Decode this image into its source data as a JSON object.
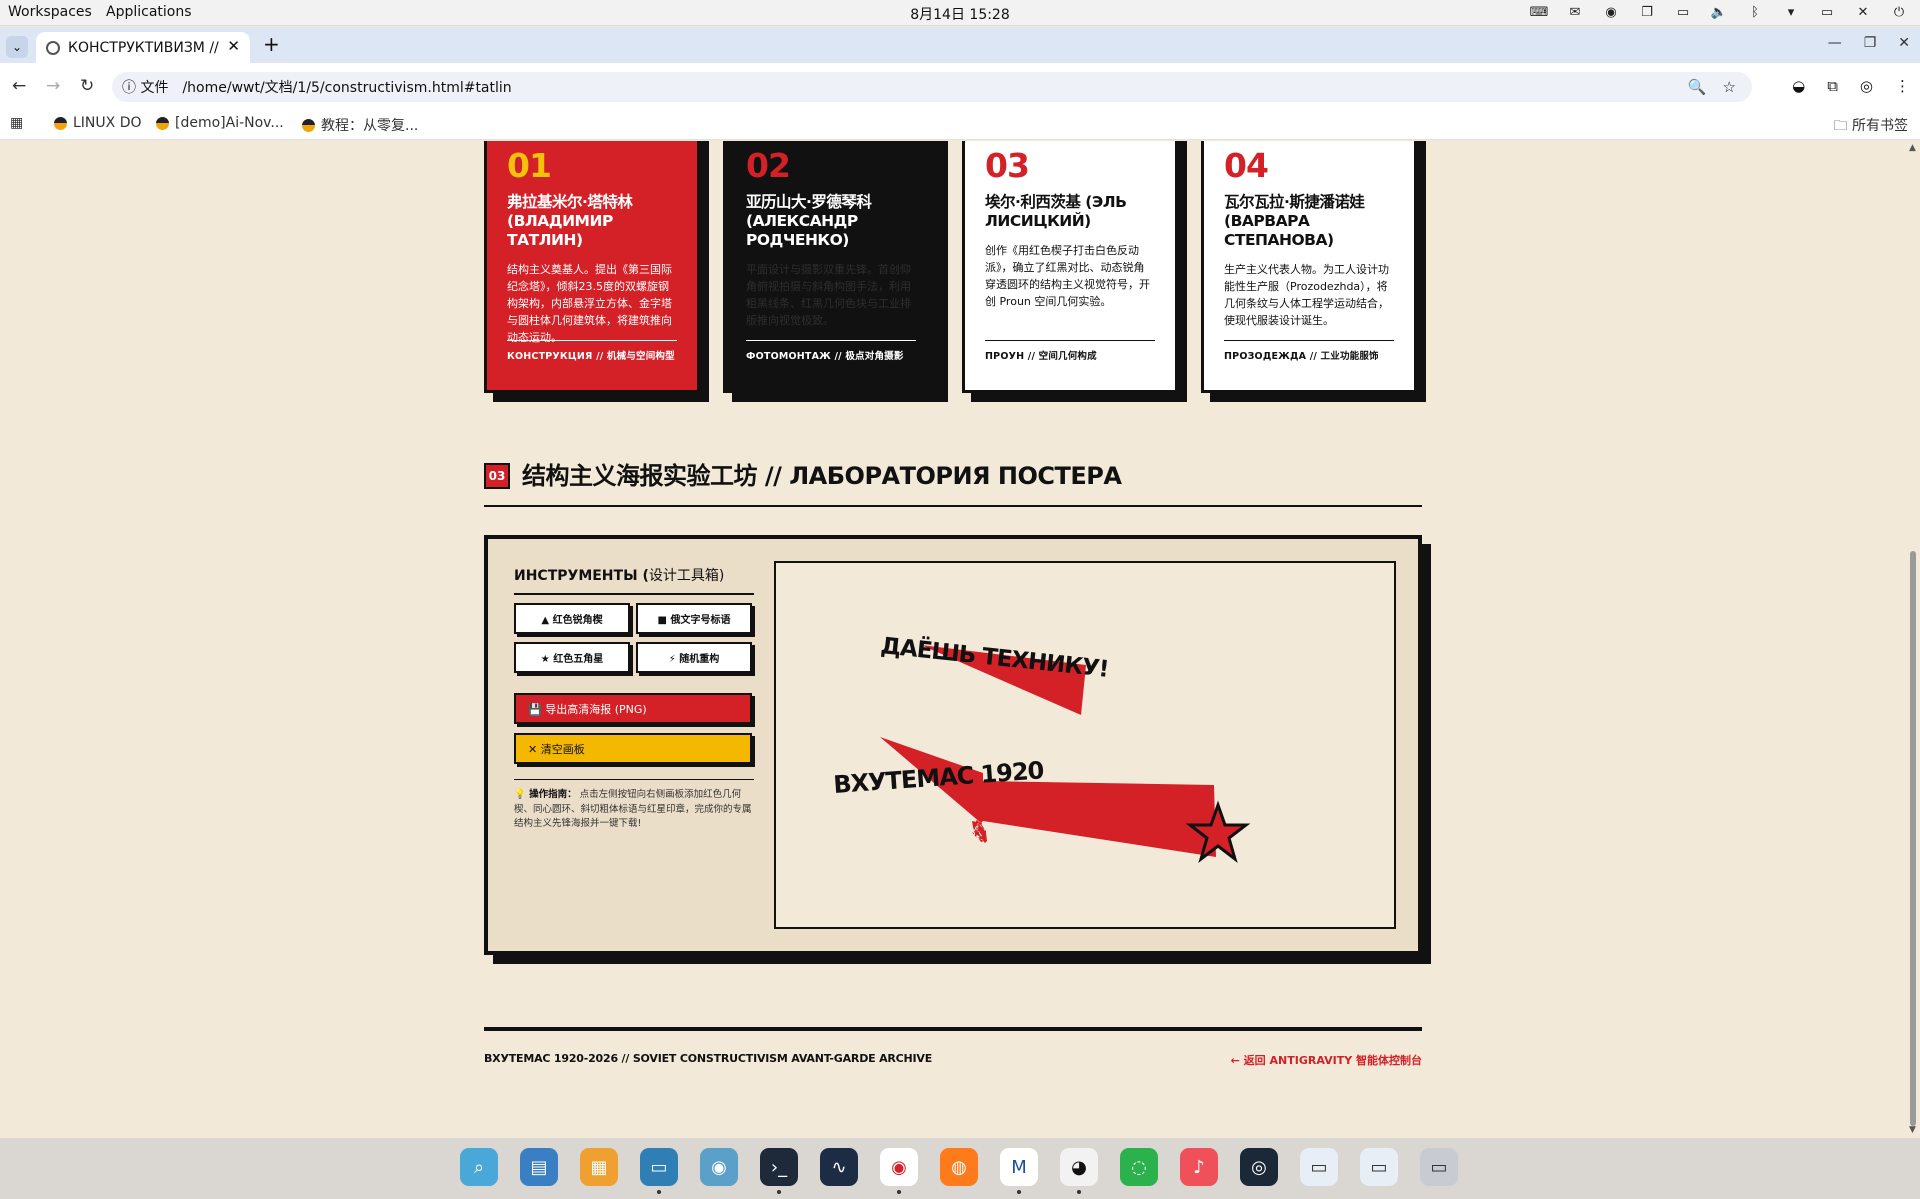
{
  "system_bar": {
    "workspaces": "Workspaces",
    "applications": "Applications",
    "datetime": "8月14日 15:28"
  },
  "browser": {
    "tab_title": "КОНСТРУКТИВИЗМ //",
    "url_chip": "文件",
    "url": "/home/wwt/文档/1/5/constructivism.html#tatlin",
    "bookmarks": [
      "LINUX DO",
      "[demo]Ai-Nov...",
      "教程：从零复..."
    ],
    "all_bookmarks": "所有书签"
  },
  "cards": [
    {
      "num": "01",
      "name": "弗拉基米尔·塔特林 (ВЛАДИМИР ТАТЛИН)",
      "desc": "结构主义奠基人。提出《第三国际纪念塔》，倾斜23.5度的双螺旋钢构架构，内部悬浮立方体、金字塔与圆柱体几何建筑体，将建筑推向动态运动。",
      "tag": "КОНСТРУКЦИЯ // 机械与空间构型"
    },
    {
      "num": "02",
      "name": "亚历山大·罗德琴科 (АЛЕКСАНДР РОДЧЕНКО)",
      "desc": "平面设计与摄影双重先锋。首创仰角俯视拍摄与斜角构图手法，利用粗黑线条、红黑几何色块与工业排版推向视觉极致。",
      "tag": "ФОТОМОНТАЖ // 极点对角摄影"
    },
    {
      "num": "03",
      "name": "埃尔·利西茨基 (ЭЛЬ ЛИСИЦКИЙ)",
      "desc": "创作《用红色楔子打击白色反动派》，确立了红黑对比、动态锐角穿透圆环的结构主义视觉符号，开创 Proun 空间几何实验。",
      "tag": "ПРОУН // 空间几何构成"
    },
    {
      "num": "04",
      "name": "瓦尔瓦拉·斯捷潘诺娃 (ВАРВАРА СТЕПАНОВА)",
      "desc": "生产主义代表人物。为工人设计功能性生产服（Prozodezhda），将几何条纹与人体工程学运动结合，使现代服装设计诞生。",
      "tag": "ПРОЗОДЕЖДА // 工业功能服饰"
    }
  ],
  "section": {
    "badge": "03",
    "title": "结构主义海报实验工坊 // ЛАБОРАТОРИЯ ПОСТЕРА"
  },
  "tools": {
    "heading": "ИНСТРУМЕНТЫ (",
    "heading_cn": "设计工具箱)",
    "buttons": [
      "▲ 红色锐角楔",
      "■ 俄文字号标语",
      "★ 红色五角星",
      "⚡ 随机重构"
    ],
    "export": "💾 导出高清海报 (PNG)",
    "clear": "✕ 清空画板",
    "guide_label": "💡 操作指南：",
    "guide_text": "点击左侧按钮向右侧画板添加红色几何楔、同心圆环、斜切粗体标语与红星印章，完成你的专属结构主义先锋海报并一键下载!"
  },
  "poster": {
    "slogan1": "ДАЁШЬ ТЕХНИКУ!",
    "slogan2": "ВХУТЕМАС 1920",
    "red": "#d42027",
    "ink": "#111111"
  },
  "footer": {
    "left": "ВХУТЕМАС 1920-2026 // SOVIET CONSTRUCTIVISM AVANT-GARDE ARCHIVE",
    "right": "← 返回 ANTIGRAVITY 智能体控制台"
  },
  "colors": {
    "accent_red": "#d42027",
    "accent_yellow": "#f4b800",
    "paper": "#f3e9d9"
  }
}
